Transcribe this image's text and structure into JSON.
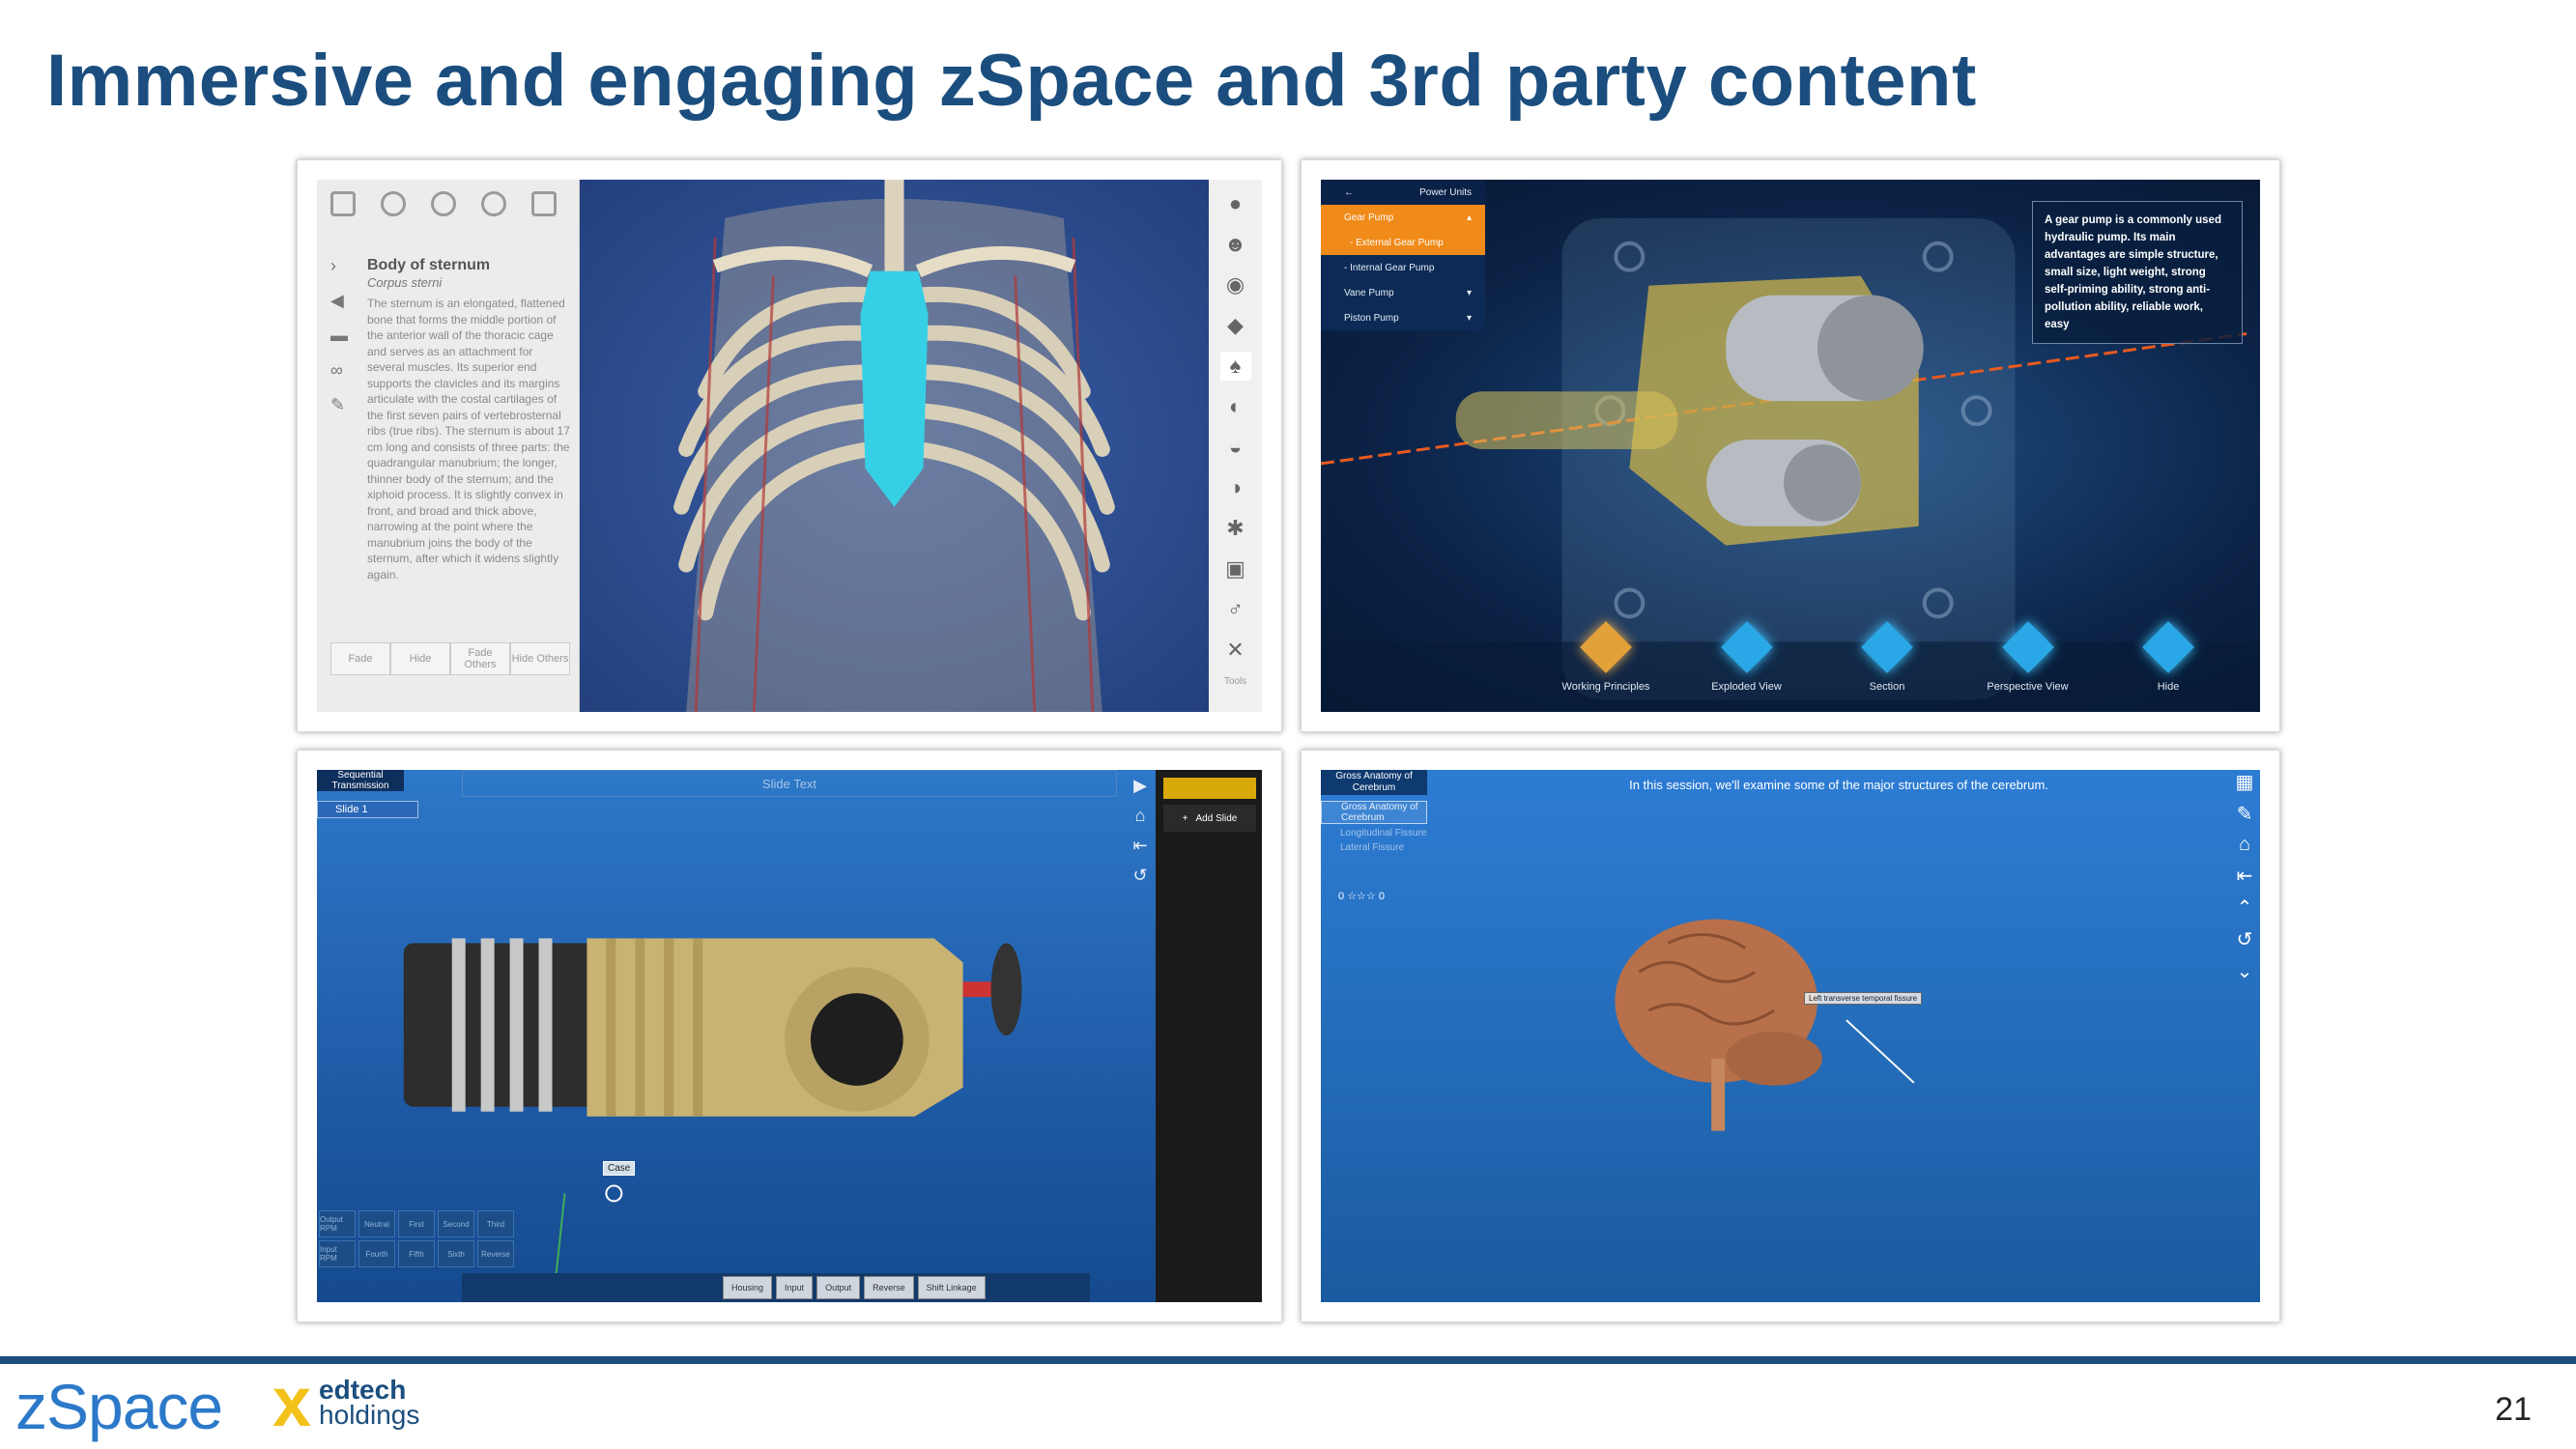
{
  "slide": {
    "title": "Immersive and engaging zSpace and 3rd party content",
    "page_number": "21"
  },
  "footer": {
    "zspace_logo": "zSpace",
    "edtech_line1": "edtech",
    "edtech_x": "x",
    "edtech_line2": "holdings"
  },
  "panel_anatomy": {
    "heading": "Body of sternum",
    "subheading": "Corpus sterni",
    "description": "The sternum is an elongated, flattened bone that forms the middle portion of the anterior wall of the thoracic cage and serves as an attachment for several muscles. Its superior end supports the clavicles and its margins articulate with the costal cartilages of the first seven pairs of vertebrosternal ribs (true ribs). The sternum is about 17 cm long and consists of three parts: the quadrangular manubrium; the longer, thinner body of the sternum; and the xiphoid process. It is slightly convex in front, and broad and thick above, narrowing at the point where the manubrium joins the body of the sternum, after which it widens slightly again.",
    "buttons": [
      "Fade",
      "Hide",
      "Fade Others",
      "Hide Others"
    ],
    "tools_label": "Tools"
  },
  "panel_gear": {
    "menu": {
      "header": "Power Units",
      "items": [
        {
          "label": "Gear Pump",
          "state": "selected"
        },
        {
          "label": "- External Gear Pump",
          "state": "sub"
        },
        {
          "label": "- Internal Gear Pump",
          "state": "normal"
        },
        {
          "label": "Vane Pump",
          "state": "normal"
        },
        {
          "label": "Piston Pump",
          "state": "normal"
        }
      ]
    },
    "info": "A gear pump is a commonly used hydraulic pump. Its main advantages are simple structure, small size, light weight, strong self-priming ability, strong anti-pollution ability, reliable work, easy",
    "bottom_buttons": [
      "Working Principles",
      "Exploded View",
      "Section",
      "Perspective View",
      "Hide"
    ]
  },
  "panel_transmission": {
    "tab": "Sequential Transmission",
    "slide_text": "Slide Text",
    "slide_item": "Slide 1",
    "add_slide": "Add Slide",
    "case_label": "Case",
    "bottom_buttons": [
      "Housing",
      "Input",
      "Output",
      "Reverse",
      "Shift Linkage"
    ],
    "grid_buttons": [
      "Output RPM",
      "Neutral",
      "First",
      "Second",
      "Third",
      "",
      "Input RPM",
      "Fourth",
      "Fifth",
      "Sixth",
      "Reverse",
      ""
    ]
  },
  "panel_brain": {
    "tab": "Gross Anatomy of Cerebrum",
    "caption": "In this session, we'll examine some of the major structures of the cerebrum.",
    "list": [
      "Gross Anatomy of Cerebrum",
      "Longitudinal Fissure",
      "Lateral Fissure"
    ],
    "score_left": "0",
    "score_right": "0",
    "label": "Left transverse temporal fissure"
  }
}
